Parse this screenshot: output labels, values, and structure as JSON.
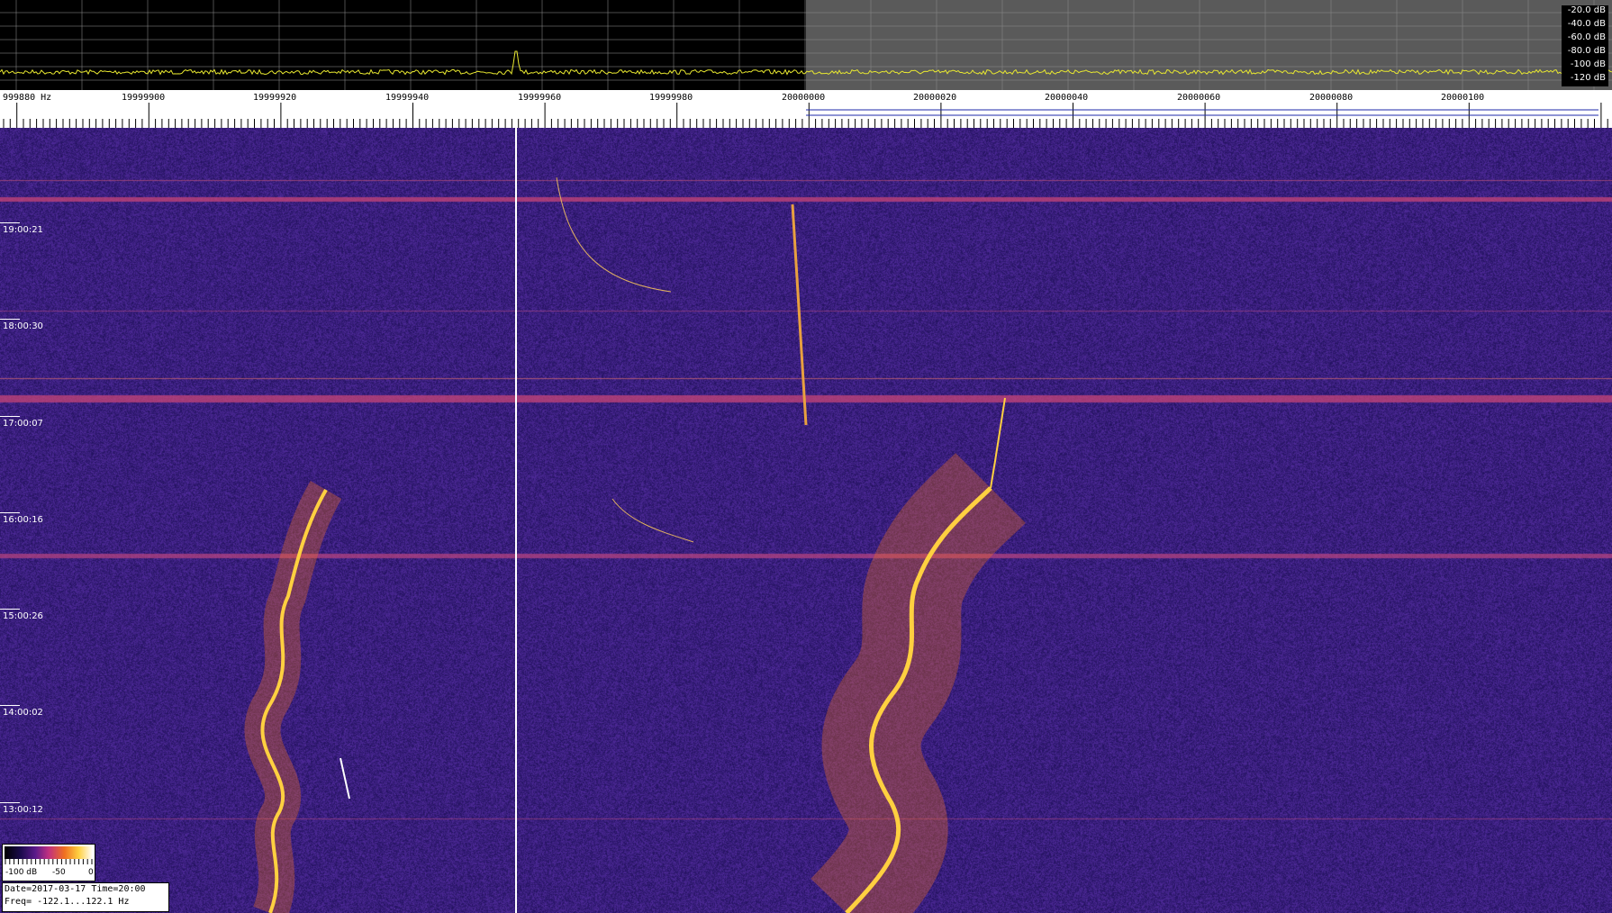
{
  "spectrum": {
    "db_scale": [
      "-20.0 dB",
      "-40.0 dB",
      "-60.0 dB",
      "-80.0 dB",
      "-100 dB",
      "-120 dB"
    ],
    "trace_color": "#e8e830",
    "background_left": "#000000",
    "background_right": "#5a5a5a"
  },
  "ruler": {
    "freq_labels": [
      "999880 Hz",
      "19999900",
      "19999920",
      "19999940",
      "19999960",
      "19999980",
      "20000000",
      "20000020",
      "20000040",
      "20000060",
      "20000080",
      "20000100"
    ]
  },
  "waterfall": {
    "time_labels": [
      "19:00:21",
      "18:00:30",
      "17:00:07",
      "16:00:16",
      "15:00:26",
      "14:00:02",
      "13:00:12"
    ],
    "background_color": "#2a1a6e",
    "signal_color": "#ffd040"
  },
  "colorbar": {
    "labels": [
      "-100 dB",
      "-50",
      "0"
    ]
  },
  "info": {
    "date_line": "Date=2017-03-17 Time=20:00",
    "freq_line": "Freq= -122.1...122.1 Hz"
  }
}
